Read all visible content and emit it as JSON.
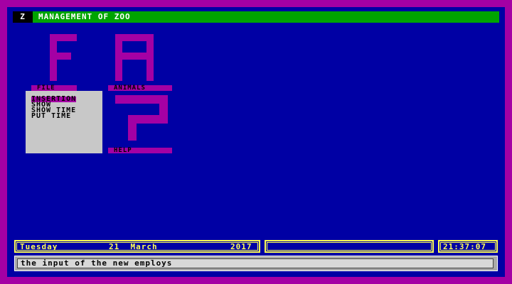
{
  "app": {
    "badge": "Z",
    "title": "MANAGEMENT OF ZOO"
  },
  "icons": [
    {
      "letter": "F",
      "label": "FILE"
    },
    {
      "letter": "A",
      "label": "ANIMALS"
    },
    {
      "letter": "?",
      "label": "HELP"
    }
  ],
  "file_menu": {
    "items": [
      "INSERTION",
      "SHOW",
      "SHOW TIME",
      "PUT TIME"
    ],
    "selected_index": 0
  },
  "status": {
    "day": "Tuesday",
    "date": "21  March",
    "year": "2017",
    "field": "",
    "time": "21:37:07"
  },
  "message": "the input of the new employs",
  "colors": {
    "screen": "#0000a4",
    "border": "#a400a4",
    "titlebar": "#00a400",
    "status": "#ffff54",
    "menu": "#c8c8c8"
  }
}
